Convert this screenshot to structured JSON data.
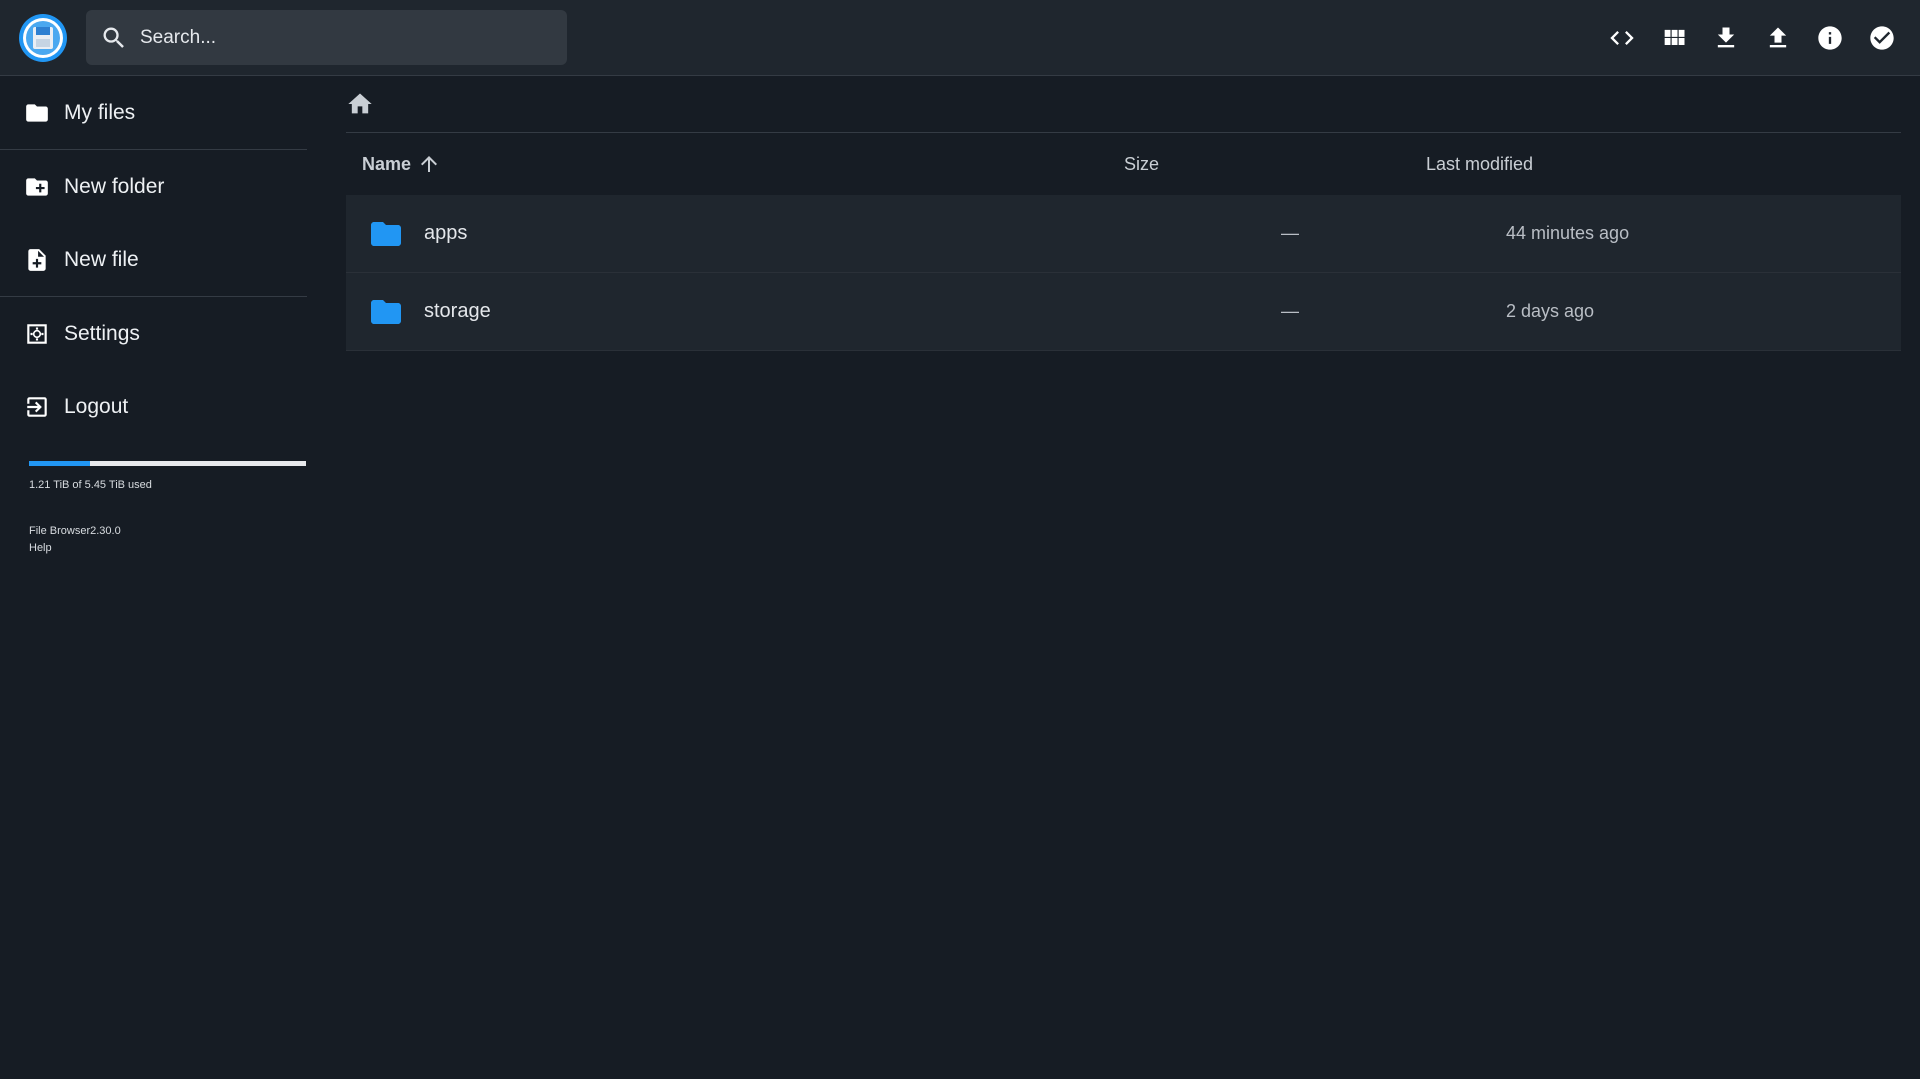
{
  "header": {
    "search_placeholder": "Search...",
    "actions": [
      {
        "name": "code-icon"
      },
      {
        "name": "grid-view-icon"
      },
      {
        "name": "download-icon"
      },
      {
        "name": "upload-icon"
      },
      {
        "name": "info-icon"
      },
      {
        "name": "select-check-icon"
      }
    ]
  },
  "sidebar": {
    "items": [
      {
        "label": "My files",
        "icon": "folder-icon"
      },
      {
        "label": "New folder",
        "icon": "create-folder-icon"
      },
      {
        "label": "New file",
        "icon": "note-add-icon"
      },
      {
        "label": "Settings",
        "icon": "settings-icon"
      },
      {
        "label": "Logout",
        "icon": "logout-icon"
      }
    ],
    "usage": {
      "text": "1.21 TiB of 5.45 TiB used",
      "fraction": 0.222
    },
    "credits": {
      "version": "File Browser2.30.0",
      "help": "Help"
    }
  },
  "main": {
    "columns": {
      "name": "Name",
      "size": "Size",
      "modified": "Last modified"
    },
    "files": [
      {
        "name": "apps",
        "size": "—",
        "modified": "44 minutes ago"
      },
      {
        "name": "storage",
        "size": "—",
        "modified": "2 days ago"
      }
    ]
  },
  "colors": {
    "accent": "#2196f3",
    "background": "#161c24",
    "surface": "#1f262e"
  }
}
